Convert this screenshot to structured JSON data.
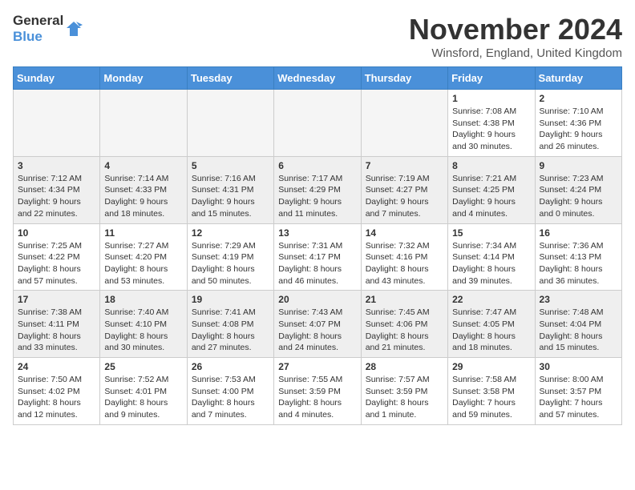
{
  "logo": {
    "line1": "General",
    "line2": "Blue"
  },
  "title": "November 2024",
  "location": "Winsford, England, United Kingdom",
  "days_of_week": [
    "Sunday",
    "Monday",
    "Tuesday",
    "Wednesday",
    "Thursday",
    "Friday",
    "Saturday"
  ],
  "weeks": [
    {
      "alt": false,
      "days": [
        {
          "num": "",
          "info": "",
          "empty": true
        },
        {
          "num": "",
          "info": "",
          "empty": true
        },
        {
          "num": "",
          "info": "",
          "empty": true
        },
        {
          "num": "",
          "info": "",
          "empty": true
        },
        {
          "num": "",
          "info": "",
          "empty": true
        },
        {
          "num": "1",
          "info": "Sunrise: 7:08 AM\nSunset: 4:38 PM\nDaylight: 9 hours\nand 30 minutes.",
          "empty": false
        },
        {
          "num": "2",
          "info": "Sunrise: 7:10 AM\nSunset: 4:36 PM\nDaylight: 9 hours\nand 26 minutes.",
          "empty": false
        }
      ]
    },
    {
      "alt": true,
      "days": [
        {
          "num": "3",
          "info": "Sunrise: 7:12 AM\nSunset: 4:34 PM\nDaylight: 9 hours\nand 22 minutes.",
          "empty": false
        },
        {
          "num": "4",
          "info": "Sunrise: 7:14 AM\nSunset: 4:33 PM\nDaylight: 9 hours\nand 18 minutes.",
          "empty": false
        },
        {
          "num": "5",
          "info": "Sunrise: 7:16 AM\nSunset: 4:31 PM\nDaylight: 9 hours\nand 15 minutes.",
          "empty": false
        },
        {
          "num": "6",
          "info": "Sunrise: 7:17 AM\nSunset: 4:29 PM\nDaylight: 9 hours\nand 11 minutes.",
          "empty": false
        },
        {
          "num": "7",
          "info": "Sunrise: 7:19 AM\nSunset: 4:27 PM\nDaylight: 9 hours\nand 7 minutes.",
          "empty": false
        },
        {
          "num": "8",
          "info": "Sunrise: 7:21 AM\nSunset: 4:25 PM\nDaylight: 9 hours\nand 4 minutes.",
          "empty": false
        },
        {
          "num": "9",
          "info": "Sunrise: 7:23 AM\nSunset: 4:24 PM\nDaylight: 9 hours\nand 0 minutes.",
          "empty": false
        }
      ]
    },
    {
      "alt": false,
      "days": [
        {
          "num": "10",
          "info": "Sunrise: 7:25 AM\nSunset: 4:22 PM\nDaylight: 8 hours\nand 57 minutes.",
          "empty": false
        },
        {
          "num": "11",
          "info": "Sunrise: 7:27 AM\nSunset: 4:20 PM\nDaylight: 8 hours\nand 53 minutes.",
          "empty": false
        },
        {
          "num": "12",
          "info": "Sunrise: 7:29 AM\nSunset: 4:19 PM\nDaylight: 8 hours\nand 50 minutes.",
          "empty": false
        },
        {
          "num": "13",
          "info": "Sunrise: 7:31 AM\nSunset: 4:17 PM\nDaylight: 8 hours\nand 46 minutes.",
          "empty": false
        },
        {
          "num": "14",
          "info": "Sunrise: 7:32 AM\nSunset: 4:16 PM\nDaylight: 8 hours\nand 43 minutes.",
          "empty": false
        },
        {
          "num": "15",
          "info": "Sunrise: 7:34 AM\nSunset: 4:14 PM\nDaylight: 8 hours\nand 39 minutes.",
          "empty": false
        },
        {
          "num": "16",
          "info": "Sunrise: 7:36 AM\nSunset: 4:13 PM\nDaylight: 8 hours\nand 36 minutes.",
          "empty": false
        }
      ]
    },
    {
      "alt": true,
      "days": [
        {
          "num": "17",
          "info": "Sunrise: 7:38 AM\nSunset: 4:11 PM\nDaylight: 8 hours\nand 33 minutes.",
          "empty": false
        },
        {
          "num": "18",
          "info": "Sunrise: 7:40 AM\nSunset: 4:10 PM\nDaylight: 8 hours\nand 30 minutes.",
          "empty": false
        },
        {
          "num": "19",
          "info": "Sunrise: 7:41 AM\nSunset: 4:08 PM\nDaylight: 8 hours\nand 27 minutes.",
          "empty": false
        },
        {
          "num": "20",
          "info": "Sunrise: 7:43 AM\nSunset: 4:07 PM\nDaylight: 8 hours\nand 24 minutes.",
          "empty": false
        },
        {
          "num": "21",
          "info": "Sunrise: 7:45 AM\nSunset: 4:06 PM\nDaylight: 8 hours\nand 21 minutes.",
          "empty": false
        },
        {
          "num": "22",
          "info": "Sunrise: 7:47 AM\nSunset: 4:05 PM\nDaylight: 8 hours\nand 18 minutes.",
          "empty": false
        },
        {
          "num": "23",
          "info": "Sunrise: 7:48 AM\nSunset: 4:04 PM\nDaylight: 8 hours\nand 15 minutes.",
          "empty": false
        }
      ]
    },
    {
      "alt": false,
      "days": [
        {
          "num": "24",
          "info": "Sunrise: 7:50 AM\nSunset: 4:02 PM\nDaylight: 8 hours\nand 12 minutes.",
          "empty": false
        },
        {
          "num": "25",
          "info": "Sunrise: 7:52 AM\nSunset: 4:01 PM\nDaylight: 8 hours\nand 9 minutes.",
          "empty": false
        },
        {
          "num": "26",
          "info": "Sunrise: 7:53 AM\nSunset: 4:00 PM\nDaylight: 8 hours\nand 7 minutes.",
          "empty": false
        },
        {
          "num": "27",
          "info": "Sunrise: 7:55 AM\nSunset: 3:59 PM\nDaylight: 8 hours\nand 4 minutes.",
          "empty": false
        },
        {
          "num": "28",
          "info": "Sunrise: 7:57 AM\nSunset: 3:59 PM\nDaylight: 8 hours\nand 1 minute.",
          "empty": false
        },
        {
          "num": "29",
          "info": "Sunrise: 7:58 AM\nSunset: 3:58 PM\nDaylight: 7 hours\nand 59 minutes.",
          "empty": false
        },
        {
          "num": "30",
          "info": "Sunrise: 8:00 AM\nSunset: 3:57 PM\nDaylight: 7 hours\nand 57 minutes.",
          "empty": false
        }
      ]
    }
  ]
}
